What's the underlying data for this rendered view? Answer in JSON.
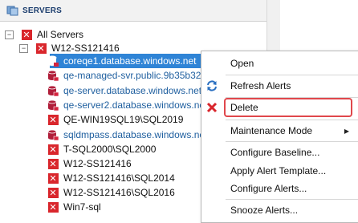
{
  "header": {
    "title": "SERVERS",
    "icon": "servers-icon"
  },
  "tree": {
    "root": {
      "label": "All Servers",
      "expander": "−"
    },
    "group": {
      "label": "W12-SS121416",
      "expander": "−"
    },
    "servers": [
      {
        "label": "coreqe1.database.windows.net",
        "icon": "azure-db-icon",
        "selected": true
      },
      {
        "label": "qe-managed-svr.public.9b35b3221a",
        "icon": "azure-db-icon"
      },
      {
        "label": "qe-server.database.windows.net",
        "icon": "azure-db-icon"
      },
      {
        "label": "qe-server2.database.windows.net",
        "icon": "azure-db-icon"
      },
      {
        "label": "QE-WIN19SQL19\\SQL2019",
        "icon": "error-icon"
      },
      {
        "label": "sqldmpass.database.windows.net",
        "icon": "azure-db-icon"
      },
      {
        "label": "T-SQL2000\\SQL2000",
        "icon": "error-icon"
      },
      {
        "label": "W12-SS121416",
        "icon": "error-icon"
      },
      {
        "label": "W12-SS121416\\SQL2014",
        "icon": "error-icon"
      },
      {
        "label": "W12-SS121416\\SQL2016",
        "icon": "error-icon"
      },
      {
        "label": "Win7-sql",
        "icon": "error-icon"
      }
    ]
  },
  "context_menu": {
    "items": [
      {
        "label": "Open"
      },
      {
        "label": "Refresh Alerts",
        "icon": "refresh-icon"
      },
      {
        "label": "Delete",
        "icon": "delete-icon",
        "highlighted": true
      },
      {
        "label": "Maintenance Mode",
        "submenu_arrow": "▶"
      },
      {
        "label": "Configure Baseline..."
      },
      {
        "label": "Apply Alert Template..."
      },
      {
        "label": "Configure Alerts..."
      },
      {
        "label": "Snooze Alerts..."
      }
    ]
  },
  "colors": {
    "selection": "#2f84d6",
    "error_red": "#d9262c",
    "highlight_border": "#e0474c",
    "azure_db": "#b01e3a"
  }
}
